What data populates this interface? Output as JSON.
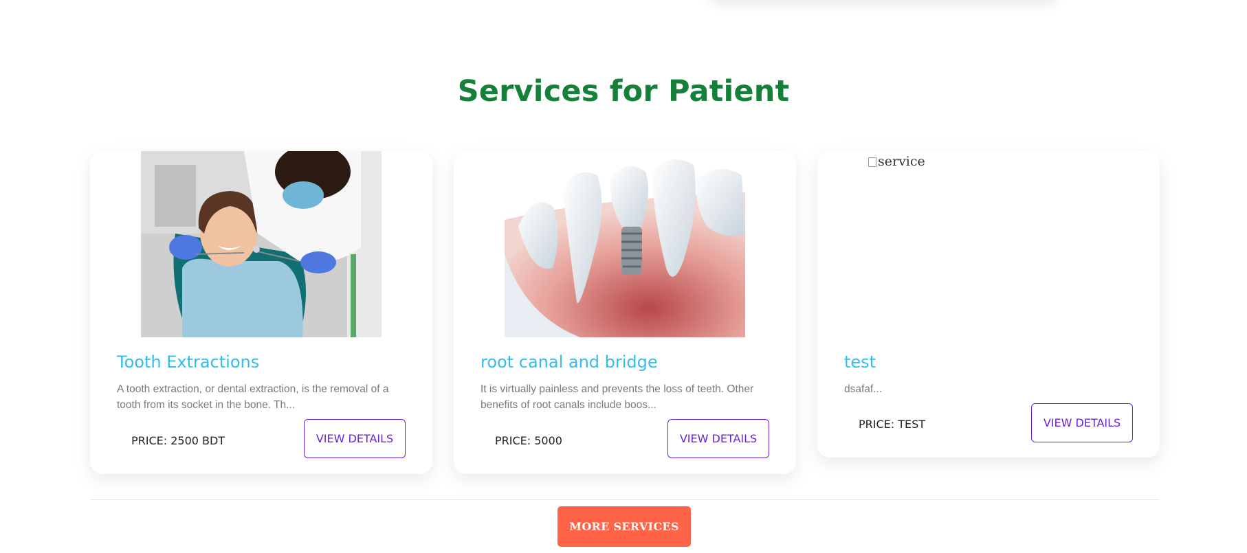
{
  "section": {
    "title": "Services for Patient"
  },
  "cards": [
    {
      "title": "Tooth Extractions",
      "description": "A tooth extraction, or dental extraction, is the removal of a tooth from its socket in the bone. Th...",
      "price": "PRICE: 2500 BDT",
      "button_label": "VIEW DETAILS",
      "image": "dentist-patient-photo"
    },
    {
      "title": "root canal and bridge",
      "description": "It is virtually painless and prevents the loss of teeth. Other benefits of root canals include boos...",
      "price": "PRICE: 5000",
      "button_label": "VIEW DETAILS",
      "image": "dental-implant-illustration"
    },
    {
      "title": "test",
      "description": "dsafaf...",
      "price": "PRICE: TEST",
      "button_label": "VIEW DETAILS",
      "image_alt": "service"
    }
  ],
  "more_button_label": "MORE SERVICES",
  "colors": {
    "title_green": "#14803a",
    "card_title_blue": "#33bdee",
    "button_purple": "#6a1fe0",
    "more_button_orange": "#ff6448"
  }
}
